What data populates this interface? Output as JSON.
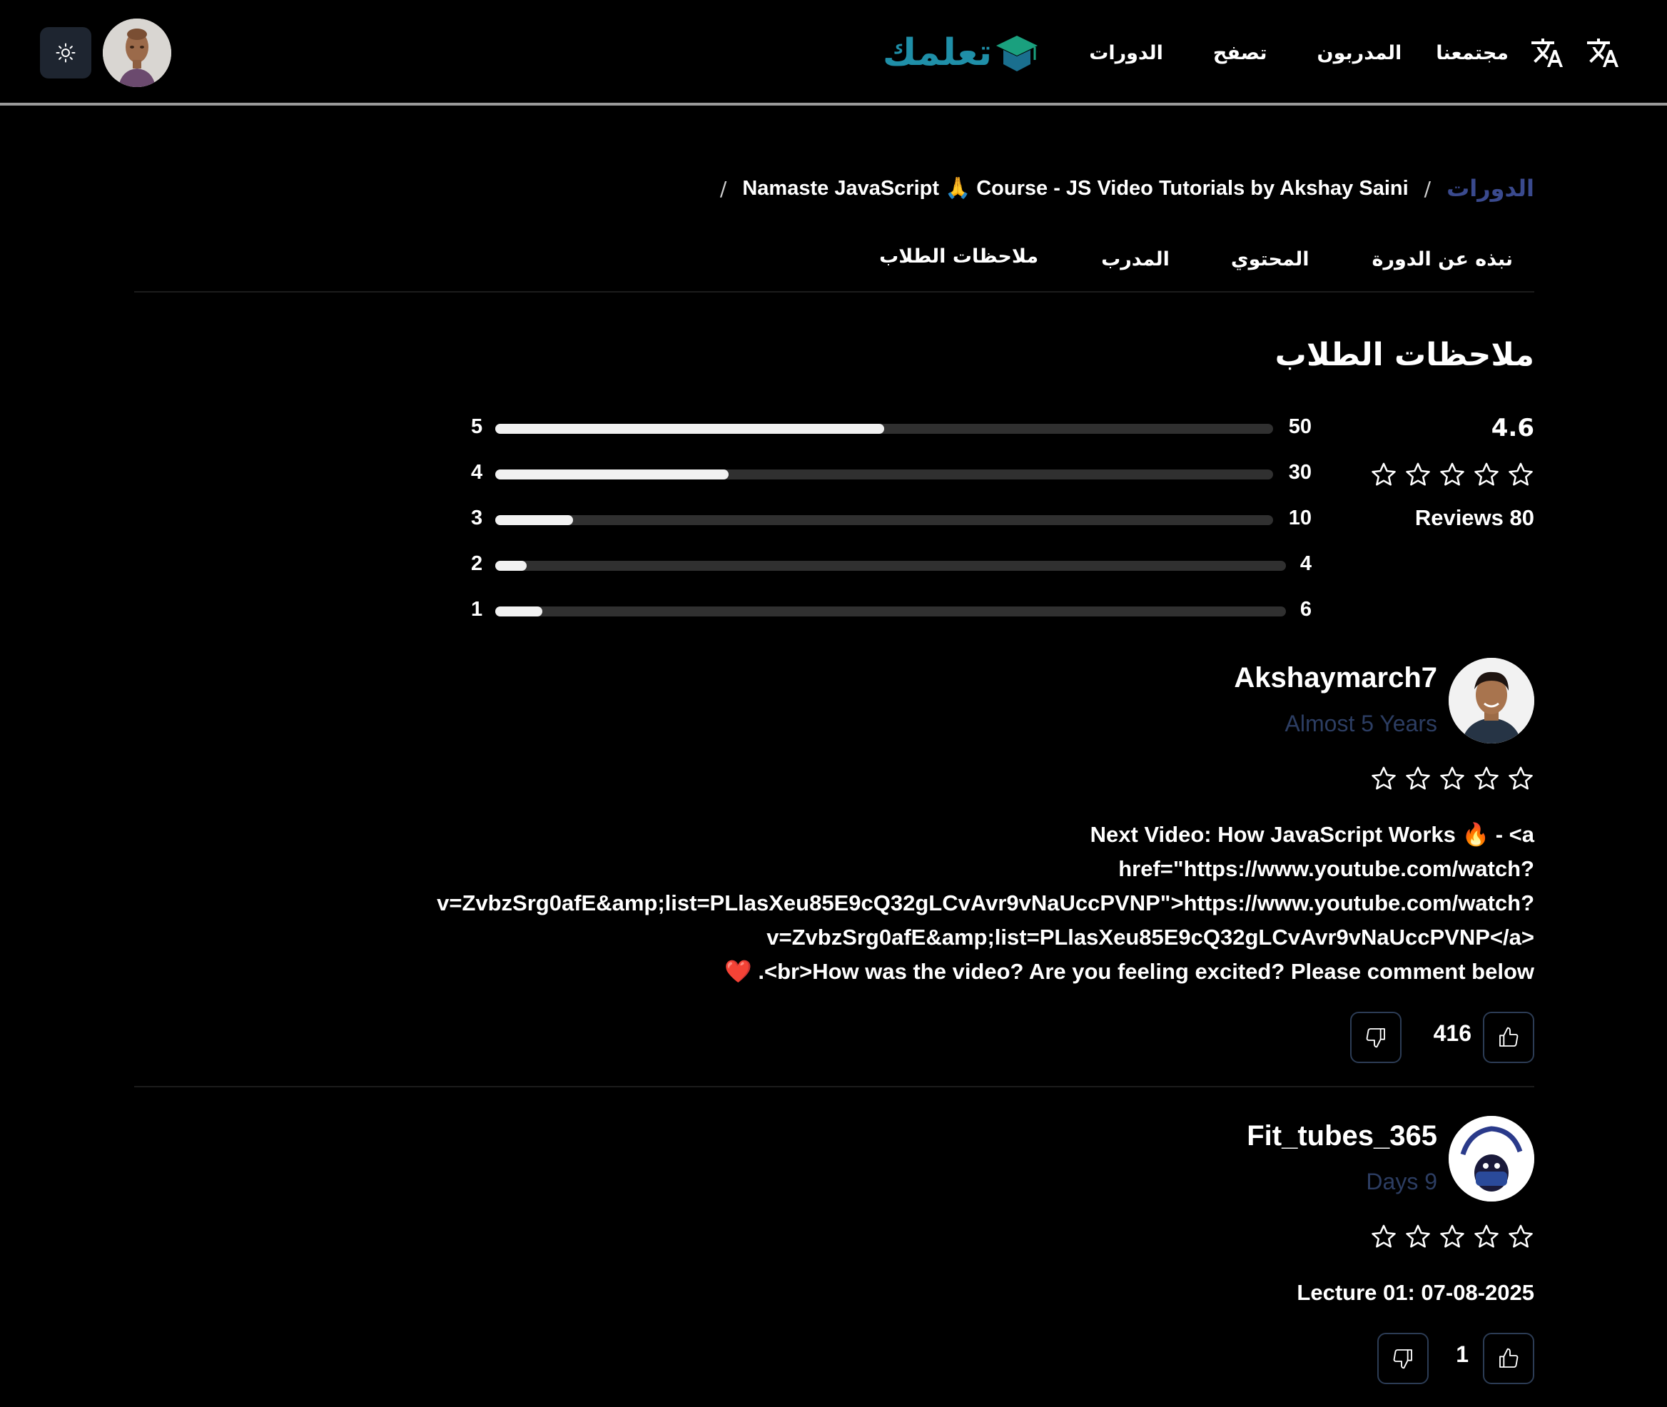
{
  "header": {
    "logo_text": "تعلمك",
    "nav": [
      "الدورات",
      "تصفح",
      "المدربون",
      "مجتمعنا"
    ],
    "colors": {
      "logo": "#1f8fa8",
      "theme_button_bg": "#1e2530"
    }
  },
  "breadcrumb": {
    "root": "الدورات",
    "separator": "/",
    "course": "Namaste JavaScript 🙏 Course - JS Video Tutorials by Akshay Saini"
  },
  "tabs": [
    "نبذه عن الدورة",
    "المحتوي",
    "المدرب",
    "ملاحظات الطلاب"
  ],
  "reviews_section": {
    "title": "ملاحظات الطلاب",
    "average": "4.6",
    "stars": 5,
    "reviews_count_label": "Reviews 80",
    "distribution": [
      {
        "stars": "5",
        "count": "50",
        "fraction": 0.5
      },
      {
        "stars": "4",
        "count": "30",
        "fraction": 0.3
      },
      {
        "stars": "3",
        "count": "10",
        "fraction": 0.1
      },
      {
        "stars": "2",
        "count": "4",
        "fraction": 0.04
      },
      {
        "stars": "1",
        "count": "6",
        "fraction": 0.06
      }
    ]
  },
  "reviews": [
    {
      "name": "Akshaymarch7",
      "time": "Almost 5 Years",
      "text_lines": [
        "Next Video: How JavaScript Works 🔥 - <a",
        "href=\"https://www.youtube.com/watch?",
        "v=ZvbzSrg0afE&amp;list=PLlasXeu85E9cQ32gLCvAvr9vNaUccPVNP\">https://www.youtube.com/watch?",
        "v=ZvbzSrg0afE&amp;list=PLlasXeu85E9cQ32gLCvAvr9vNaUccPVNP</a>",
        "❤️ .<br>How was the video? Are you feeling excited? Please comment below"
      ],
      "likes": "416"
    },
    {
      "name": "Fit_tubes_365",
      "time": "Days 9",
      "text_lines": [
        "Lecture 01: 07-08-2025"
      ],
      "likes": "1"
    }
  ]
}
